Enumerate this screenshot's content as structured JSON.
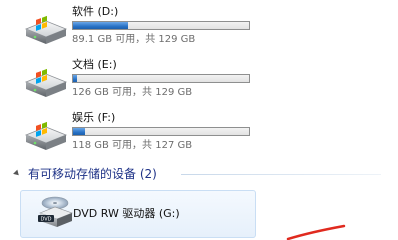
{
  "hard_drives": [
    {
      "name": "软件 (D:)",
      "stats": "89.1 GB 可用，共 129 GB",
      "used_fraction": 0.31,
      "icon": "hard-drive-icon"
    },
    {
      "name": "文档 (E:)",
      "stats": "126 GB 可用，共 129 GB",
      "used_fraction": 0.02,
      "icon": "hard-drive-icon"
    },
    {
      "name": "娱乐 (F:)",
      "stats": "118 GB 可用，共 127 GB",
      "used_fraction": 0.07,
      "icon": "hard-drive-icon"
    }
  ],
  "removable_group": {
    "title": "有可移动存储的设备 (2)",
    "devices": [
      {
        "name": "DVD RW 驱动器 (G:)",
        "badge": "DVD",
        "icon": "dvd-drive-icon"
      }
    ]
  },
  "colors": {
    "bar_fill": "#2a73c7",
    "group_title": "#1e3287",
    "tile_border": "#c9def4",
    "annotation_stroke": "#e02a1f"
  }
}
